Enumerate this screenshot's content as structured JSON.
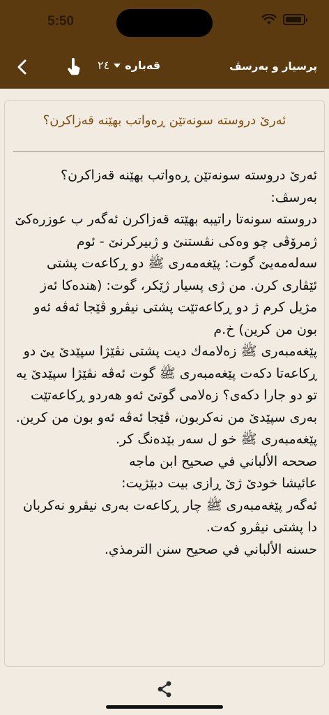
{
  "status": {
    "time": "5:50"
  },
  "toolbar": {
    "title": "پرسیار و بەرسڤ",
    "chapter_label": "قەبارە",
    "chapter_number": "٢٤"
  },
  "question": {
    "title": "ئەرێ دروستە سونەتێن ڕەواتب بهێنە قەزاکرن؟"
  },
  "answer": {
    "lines": [
      "ئەرێ دروستە سونەتێن ڕەواتب بهێنە قەزاکرن؟",
      "بەرسڤ:",
      "دروستە سونەتا راتیبە بهێتە قەزاکرن ئەگەر ب عوزرەکێ ژمرۆڤی چو وەکی نڤستنێ و ژبیرکرنێ - ئوم سەلەمەیێ گوت: پێغەمەری ﷺ دو ڕکاعەت پشتی ئێڤاری کرن. من ژی پسیار ژێکر، گوت: (هندەکا ئەز مژیل کرم ژ دو ڕکاعەتێت پشتی نیڤرو ڤێجا ئەڤە ئەو بون من کرین) خ.م",
      "پێغەمبەری ﷺ زەلامەك دیت پشتی نڤێژا سپێدێ یێ دو ڕکاعەتا دکەت پێغەمبەری ﷺ گوت ئەڤە نڤێژا سپێدێ یە تو دو جارا دکەی؟ زەلامی گوتێ ئەو هەردو ڕکاعەتێت بەری سپێدێ من نەکربون، ڤێجا ئەڤە ئەو بون من کرین. پێغەمبەری ﷺ خو ل سەر بێدەنگ کر.",
      "صححه الألباني في صحيح ابن ماجه",
      "عائیشا خودێ ژێ ڕازی بیت دبێژیت:",
      "ئەگەر پێغەمبەری ﷺ چار ڕکاعەت بەری نیڤرو نەکربان دا پشتی نیڤرو کەت.",
      "حسنه الألباني في صحيح سنن الترمذي."
    ]
  },
  "colors": {
    "header": "#5a3a0e",
    "accent_title": "#7b4f10",
    "background": "#f1ebe1"
  },
  "icons": {
    "back": "chevron-left-icon",
    "hand": "hand-pointer-icon",
    "share": "share-icon"
  }
}
